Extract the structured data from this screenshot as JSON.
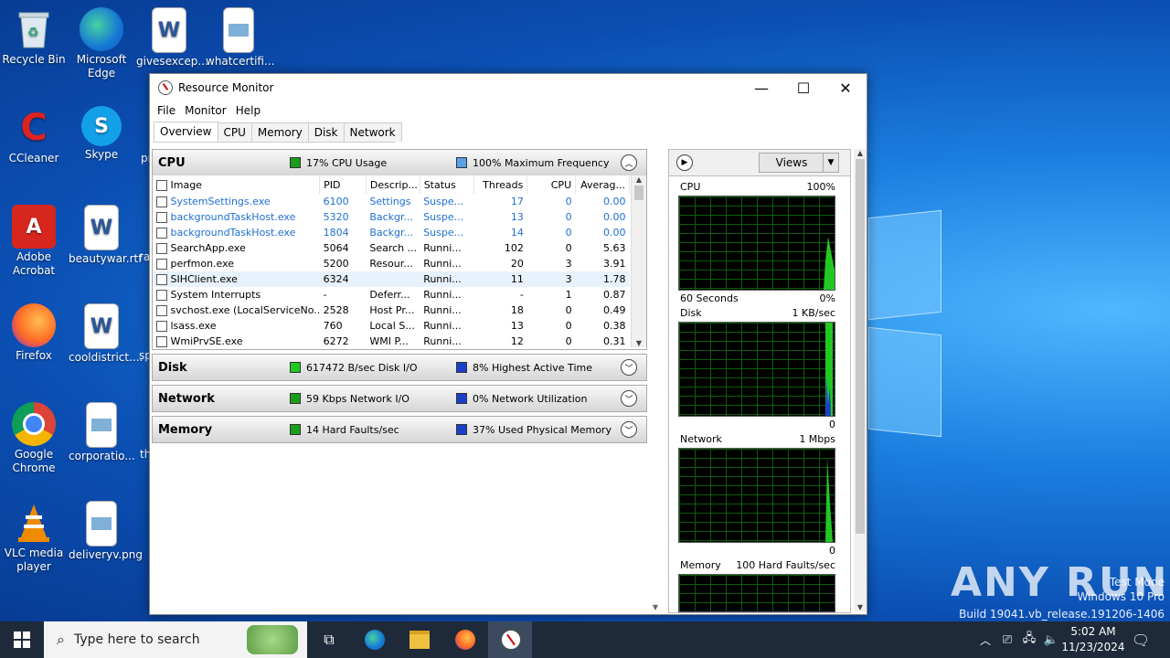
{
  "desktop": {
    "icons": [
      {
        "label": "Recycle Bin",
        "icon": "recycle-bin-icon"
      },
      {
        "label": "Microsoft Edge",
        "icon": "edge-icon"
      },
      {
        "label": "givesexcep...",
        "icon": "word-doc-icon"
      },
      {
        "label": "whatcertifi...",
        "icon": "image-file-icon"
      },
      {
        "label": "CCleaner",
        "icon": "ccleaner-icon"
      },
      {
        "label": "Skype",
        "icon": "skype-icon"
      },
      {
        "label": "Adobe Acrobat",
        "icon": "acrobat-icon"
      },
      {
        "label": "beautywar.rtf",
        "icon": "word-doc-icon"
      },
      {
        "label": "Firefox",
        "icon": "firefox-icon"
      },
      {
        "label": "cooldistrict....",
        "icon": "word-doc-icon"
      },
      {
        "label": "Google Chrome",
        "icon": "chrome-icon"
      },
      {
        "label": "corporatio...",
        "icon": "image-file-icon"
      },
      {
        "label": "VLC media player",
        "icon": "vlc-icon"
      },
      {
        "label": "deliveryv.png",
        "icon": "image-file-icon"
      }
    ],
    "partial_labels": [
      "pr",
      "ra",
      "sp",
      "th"
    ],
    "watermark": {
      "brand": "ANY RUN",
      "line1": "Test Mode",
      "line2": "Windows 10 Pro",
      "line3": "Build 19041.vb_release.191206-1406"
    }
  },
  "window": {
    "title": "Resource Monitor",
    "controls": {
      "minimize": "—",
      "maximize": "☐",
      "close": "✕"
    },
    "menu": [
      "File",
      "Monitor",
      "Help"
    ],
    "tabs": [
      "Overview",
      "CPU",
      "Memory",
      "Disk",
      "Network"
    ],
    "active_tab": "Overview",
    "sections": {
      "cpu": {
        "name": "CPU",
        "ind1": "17% CPU Usage",
        "ind2": "100% Maximum Frequency",
        "columns": [
          "Image",
          "PID",
          "Descrip...",
          "Status",
          "Threads",
          "CPU",
          "Averag..."
        ],
        "rows": [
          {
            "image": "SystemSettings.exe",
            "pid": "6100",
            "desc": "Settings",
            "status": "Suspe...",
            "threads": "17",
            "cpu": "0",
            "avg": "0.00",
            "style": "blue"
          },
          {
            "image": "backgroundTaskHost.exe",
            "pid": "5320",
            "desc": "Backgr...",
            "status": "Suspe...",
            "threads": "13",
            "cpu": "0",
            "avg": "0.00",
            "style": "blue"
          },
          {
            "image": "backgroundTaskHost.exe",
            "pid": "1804",
            "desc": "Backgr...",
            "status": "Suspe...",
            "threads": "14",
            "cpu": "0",
            "avg": "0.00",
            "style": "blue"
          },
          {
            "image": "SearchApp.exe",
            "pid": "5064",
            "desc": "Search ...",
            "status": "Runni...",
            "threads": "102",
            "cpu": "0",
            "avg": "5.63",
            "style": ""
          },
          {
            "image": "perfmon.exe",
            "pid": "5200",
            "desc": "Resour...",
            "status": "Runni...",
            "threads": "20",
            "cpu": "3",
            "avg": "3.91",
            "style": ""
          },
          {
            "image": "SIHClient.exe",
            "pid": "6324",
            "desc": "",
            "status": "Runni...",
            "threads": "11",
            "cpu": "3",
            "avg": "1.78",
            "style": "sel"
          },
          {
            "image": "System Interrupts",
            "pid": "-",
            "desc": "Deferr...",
            "status": "Runni...",
            "threads": "-",
            "cpu": "1",
            "avg": "0.87",
            "style": ""
          },
          {
            "image": "svchost.exe (LocalServiceNo...",
            "pid": "2528",
            "desc": "Host Pr...",
            "status": "Runni...",
            "threads": "18",
            "cpu": "0",
            "avg": "0.49",
            "style": ""
          },
          {
            "image": "lsass.exe",
            "pid": "760",
            "desc": "Local S...",
            "status": "Runni...",
            "threads": "13",
            "cpu": "0",
            "avg": "0.38",
            "style": ""
          },
          {
            "image": "WmiPrvSE.exe",
            "pid": "6272",
            "desc": "WMI P...",
            "status": "Runni...",
            "threads": "12",
            "cpu": "0",
            "avg": "0.31",
            "style": ""
          }
        ]
      },
      "disk": {
        "name": "Disk",
        "ind1": "617472 B/sec Disk I/O",
        "ind2": "8% Highest Active Time"
      },
      "network": {
        "name": "Network",
        "ind1": "59 Kbps Network I/O",
        "ind2": "0% Network Utilization"
      },
      "memory": {
        "name": "Memory",
        "ind1": "14 Hard Faults/sec",
        "ind2": "37% Used Physical Memory"
      }
    },
    "right_panel": {
      "views_label": "Views",
      "graphs": [
        {
          "name": "CPU",
          "max": "100%",
          "footer_left": "60 Seconds",
          "footer_right": "0%"
        },
        {
          "name": "Disk",
          "max": "1 KB/sec",
          "footer_left": "",
          "footer_right": "0"
        },
        {
          "name": "Network",
          "max": "1 Mbps",
          "footer_left": "",
          "footer_right": "0"
        },
        {
          "name": "Memory",
          "max": "100 Hard Faults/sec",
          "footer_left": "",
          "footer_right": ""
        }
      ]
    }
  },
  "taskbar": {
    "search_placeholder": "Type here to search",
    "time": "5:02 AM",
    "date": "11/23/2024"
  },
  "colors": {
    "cpu_usage": "#1a9e1a",
    "max_freq": "#5aa0e8",
    "disk_io": "#22c822",
    "active_time": "#1a3fc8",
    "link_blue": "#1e6fd1",
    "graph_grid": "#0b5d0b"
  }
}
